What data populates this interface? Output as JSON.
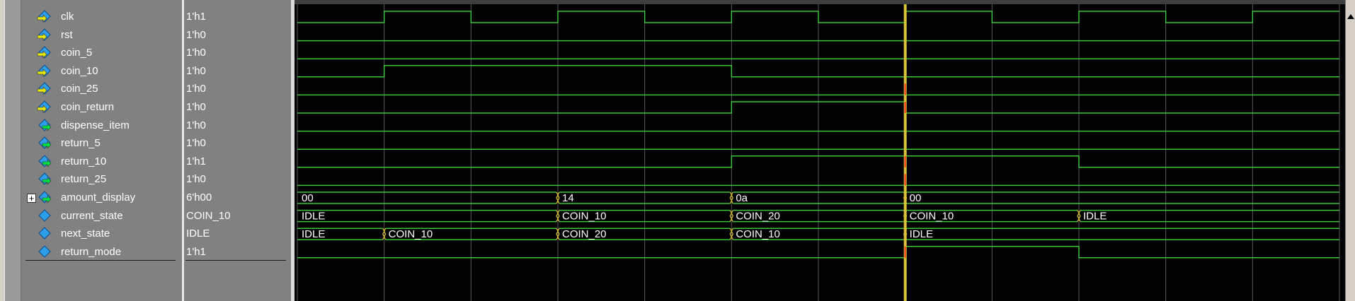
{
  "window": {
    "title": ""
  },
  "signals": [
    {
      "name": "clk",
      "value": "1'h1",
      "kind": "input"
    },
    {
      "name": "rst",
      "value": "1'h0",
      "kind": "input"
    },
    {
      "name": "coin_5",
      "value": "1'h0",
      "kind": "input"
    },
    {
      "name": "coin_10",
      "value": "1'h0",
      "kind": "input"
    },
    {
      "name": "coin_25",
      "value": "1'h0",
      "kind": "input"
    },
    {
      "name": "coin_return",
      "value": "1'h0",
      "kind": "input"
    },
    {
      "name": "dispense_item",
      "value": "1'h0",
      "kind": "output"
    },
    {
      "name": "return_5",
      "value": "1'h0",
      "kind": "output"
    },
    {
      "name": "return_10",
      "value": "1'h1",
      "kind": "output"
    },
    {
      "name": "return_25",
      "value": "1'h0",
      "kind": "output"
    },
    {
      "name": "amount_display",
      "value": "6'h00",
      "kind": "output",
      "expandable": true,
      "expand_symbol": "+"
    },
    {
      "name": "current_state",
      "value": "COIN_10",
      "kind": "internal"
    },
    {
      "name": "next_state",
      "value": "IDLE",
      "kind": "internal"
    },
    {
      "name": "return_mode",
      "value": "1'h1",
      "kind": "internal"
    }
  ],
  "waveforms": {
    "time_range": [
      0,
      12
    ],
    "cursor_time": 7,
    "digital": {
      "clk": {
        "init": 0,
        "edges": [
          1,
          2,
          3,
          4,
          5,
          6,
          7,
          8,
          9,
          10,
          11
        ]
      },
      "rst": {
        "init": 0,
        "edges": []
      },
      "coin_5": {
        "init": 0,
        "edges": []
      },
      "coin_10": {
        "init": 0,
        "edges": [
          1,
          5
        ]
      },
      "coin_25": {
        "init": 0,
        "edges": []
      },
      "coin_return": {
        "init": 0,
        "edges": [
          5,
          7
        ]
      },
      "dispense_item": {
        "init": 0,
        "edges": []
      },
      "return_5": {
        "init": 0,
        "edges": []
      },
      "return_10": {
        "init": 0,
        "edges": [
          5,
          9
        ]
      },
      "return_25": {
        "init": 0,
        "edges": []
      },
      "return_mode": {
        "init": 0,
        "edges": [
          7,
          9
        ]
      }
    },
    "bus": {
      "amount_display": [
        {
          "t": 0,
          "label": "00"
        },
        {
          "t": 3,
          "label": "14"
        },
        {
          "t": 5,
          "label": "0a"
        },
        {
          "t": 7,
          "label": "00"
        }
      ],
      "current_state": [
        {
          "t": 0,
          "label": "IDLE"
        },
        {
          "t": 3,
          "label": "COIN_10"
        },
        {
          "t": 5,
          "label": "COIN_20"
        },
        {
          "t": 7,
          "label": "COIN_10"
        },
        {
          "t": 9,
          "label": "IDLE"
        }
      ],
      "next_state": [
        {
          "t": 0,
          "label": "IDLE"
        },
        {
          "t": 1,
          "label": "COIN_10"
        },
        {
          "t": 3,
          "label": "COIN_20"
        },
        {
          "t": 5,
          "label": "COIN_10"
        },
        {
          "t": 7,
          "label": "IDLE"
        }
      ]
    }
  },
  "colors": {
    "wave": "#39c43b",
    "grid": "#5a5a5a",
    "cursor": "#d8c238",
    "cursor_mark": "#ff3a1a",
    "bus_edge_mark": "#d8c238",
    "icon_diamond": "#2f9ee8",
    "icon_arrow_in": "#e8e800",
    "icon_arrow_out": "#00e040"
  },
  "icons": {
    "input": "input-port-icon",
    "output": "output-port-icon",
    "internal": "signal-icon"
  }
}
